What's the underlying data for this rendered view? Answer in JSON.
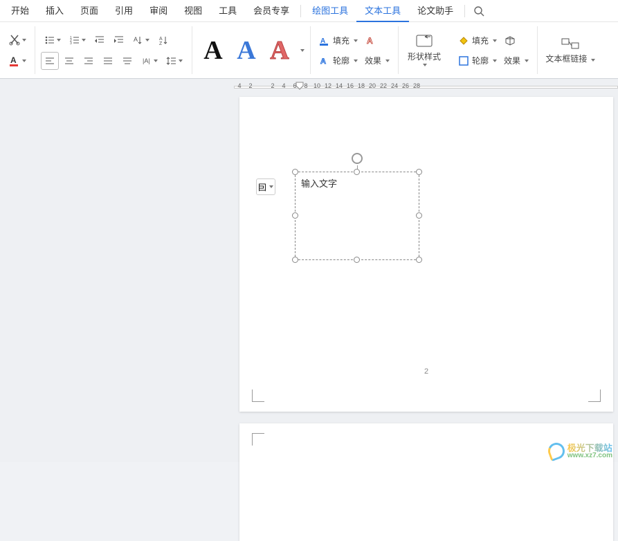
{
  "menu": {
    "tabs": [
      "开始",
      "插入",
      "页面",
      "引用",
      "审阅",
      "视图",
      "工具",
      "会员专享"
    ],
    "tool_tabs": [
      "绘图工具",
      "文本工具"
    ],
    "extra_tabs": [
      "论文助手"
    ],
    "active_index": 1
  },
  "ribbon": {
    "style_preview": {
      "a1": "A",
      "a2": "A",
      "a3": "A"
    },
    "text_fill": "填充",
    "text_outline": "轮廓",
    "text_effect": "效果",
    "shape_style": "形状样式",
    "shape_fill": "填充",
    "shape_outline": "轮廓",
    "shape_effect": "效果",
    "textbox_link": "文本框链接"
  },
  "ruler": {
    "labels": [
      "4",
      "2",
      "",
      "2",
      "4",
      "6",
      "8",
      "10",
      "12",
      "14",
      "16",
      "18",
      "20",
      "22",
      "24",
      "26",
      "28"
    ]
  },
  "document": {
    "textbox_placeholder": "输入文字",
    "page_number": "2",
    "layout_icon": "囙"
  },
  "watermark": {
    "cn": "极光下载站",
    "en": "www.xz7.com"
  }
}
